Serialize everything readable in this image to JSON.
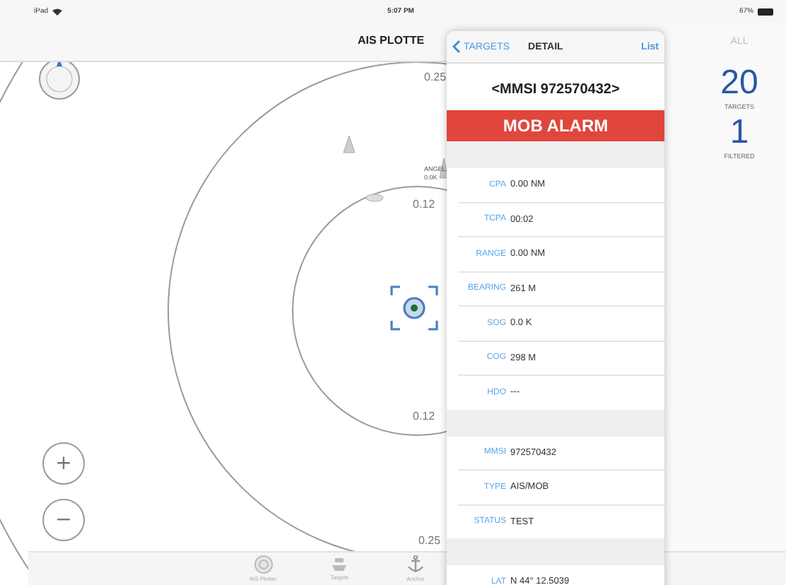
{
  "status_bar": {
    "device": "iPad",
    "time": "5:07 PM",
    "battery": "67%"
  },
  "nav_bar": {
    "title": "AIS PLOTTE"
  },
  "map": {
    "range_labels": [
      "0.25",
      "0.12",
      "0.12",
      "0.25"
    ],
    "target": {
      "name": "ANGEL",
      "speed": "0.0K"
    },
    "zoom_in": "+",
    "zoom_out": "−"
  },
  "tab_bar": {
    "tabs": [
      {
        "label": "AIS Plotter",
        "kind": "radar"
      },
      {
        "label": "Targets",
        "kind": "ship"
      },
      {
        "label": "Anchor",
        "kind": "anchor"
      }
    ]
  },
  "right_panel": {
    "filter": "ALL",
    "targets_count": "20",
    "targets_label": "TARGETS",
    "filtered_count": "1",
    "filtered_label": "FILTERED"
  },
  "detail": {
    "back": "TARGETS",
    "title": "DETAIL",
    "action": "List",
    "header": "<MMSI 972570432>",
    "alarm": "MOB ALARM",
    "groups": [
      [
        {
          "label": "CPA",
          "value": "0.00 NM"
        },
        {
          "label": "TCPA",
          "value": "00:02"
        },
        {
          "label": "RANGE",
          "value": "0.00 NM"
        },
        {
          "label": "BEARING",
          "value": "261 M"
        },
        {
          "label": "SOG",
          "value": "0.0 K"
        },
        {
          "label": "COG",
          "value": "298 M"
        },
        {
          "label": "HDO",
          "value": "---"
        }
      ],
      [
        {
          "label": "MMSI",
          "value": "972570432"
        },
        {
          "label": "TYPE",
          "value": "AIS/MOB"
        },
        {
          "label": "STATUS",
          "value": "TEST"
        }
      ],
      [
        {
          "label": "LAT",
          "value": "N 44° 12.5039"
        }
      ]
    ]
  }
}
